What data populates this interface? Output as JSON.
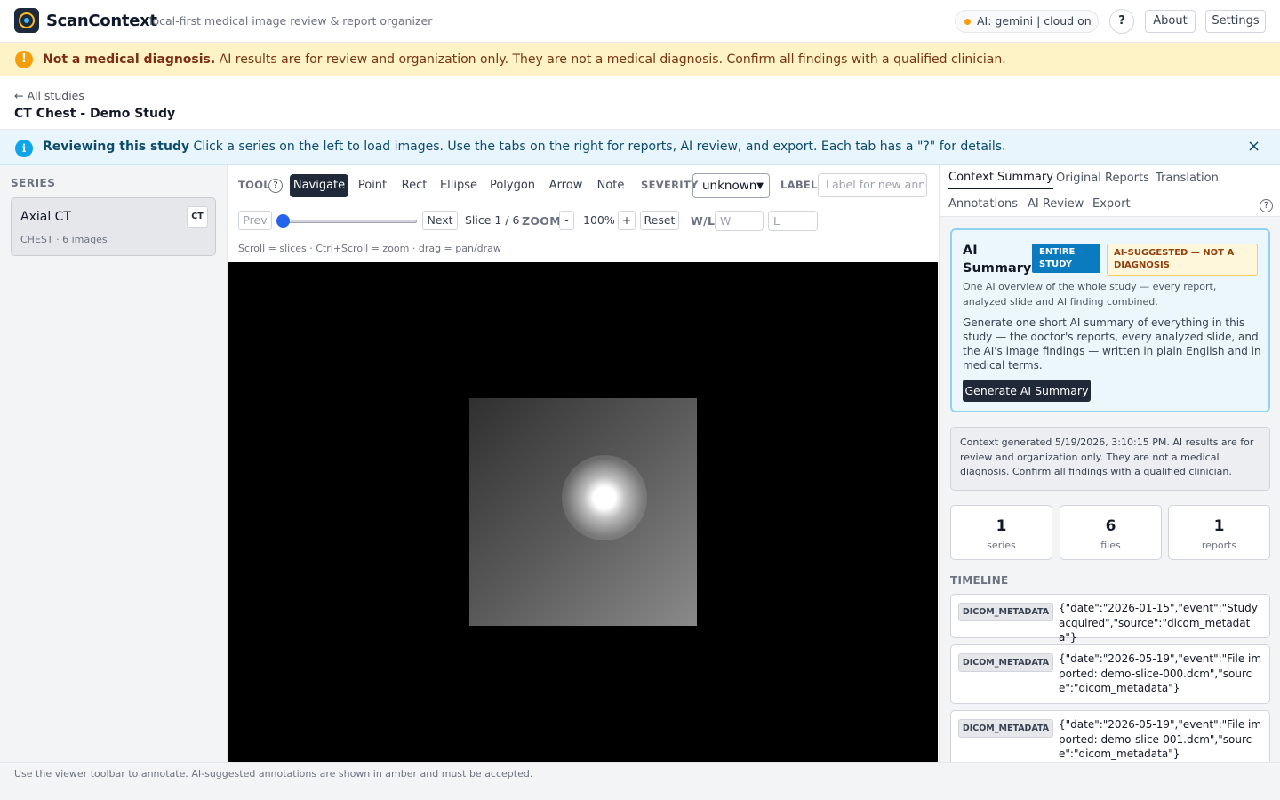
{
  "app": {
    "name": "ScanContext",
    "tagline": "local-first medical image review & report organizer",
    "ai_status": "AI:  gemini  |  cloud on",
    "help_label": "?",
    "about_label": "About",
    "settings_label": "Settings",
    "status_color": "#f59e0b"
  },
  "warning": {
    "icon": "!",
    "title": "Not a medical diagnosis.",
    "text": " AI results are for review and organization only. They are not a medical diagnosis. Confirm all findings with a qualified clinician."
  },
  "breadcrumb": {
    "back": "← All studies",
    "title": "CT Chest - Demo Study"
  },
  "info": {
    "icon": "i",
    "title": "Reviewing this study",
    "text": " Click a series on the left to load images. Use the tabs on the right for reports, AI review, and export. Each tab has a \"?\" for details.",
    "close": "×"
  },
  "series": {
    "header": "SERIES",
    "items": [
      {
        "name": "Axial CT",
        "meta": "CHEST · 6 images",
        "modality": "CT"
      }
    ]
  },
  "viewer": {
    "tool_label": "TOOL",
    "tool_help": "?",
    "tools": [
      "Navigate",
      "Point",
      "Rect",
      "Ellipse",
      "Polygon",
      "Arrow",
      "Note"
    ],
    "active_tool": "Navigate",
    "severity_label": "SEVERITY",
    "severity_value": "unknown",
    "label_label": "LABEL",
    "label_placeholder": "Label for new annotation",
    "prev": "Prev",
    "next": "Next",
    "slice_text": "Slice 1 / 6",
    "slice_position": 0,
    "zoom_label": "ZOOM",
    "zoom_minus": "-",
    "zoom_value": "100%",
    "zoom_plus": "+",
    "reset": "Reset",
    "wl_label": "W/L",
    "w_placeholder": "W",
    "l_placeholder": "L",
    "hint": "Scroll = slices · Ctrl+Scroll = zoom · drag = pan/draw"
  },
  "right": {
    "tabs": [
      "Context Summary",
      "Original Reports",
      "Translation",
      "Annotations",
      "AI Review",
      "Export"
    ],
    "active_tab": "Context Summary",
    "help": "?",
    "ai_summary": {
      "title": "AI Summary",
      "badge_scope": "ENTIRE STUDY",
      "badge_warning": "AI-SUGGESTED — NOT A DIAGNOSIS",
      "subtitle": "One AI overview of the whole study — every report, analyzed slide and AI finding combined.",
      "body": "Generate one short AI summary of everything in this study — the doctor's reports, every analyzed slide, and the AI's image findings — written in plain English and in medical terms.",
      "button": "Generate AI Summary"
    },
    "context_note": "Context generated 5/19/2026, 3:10:15 PM. AI results are for review and organization only. They are not a medical diagnosis. Confirm all findings with a qualified clinician.",
    "stats": [
      {
        "value": "1",
        "label": "series"
      },
      {
        "value": "6",
        "label": "files"
      },
      {
        "value": "1",
        "label": "reports"
      }
    ],
    "timeline_header": "TIMELINE",
    "timeline": [
      {
        "tag": "DICOM_METADATA",
        "text": "{\"date\":\"2026-01-15\",\"event\":\"Study acquired\",\"source\":\"dicom_metadata\"}"
      },
      {
        "tag": "DICOM_METADATA",
        "text": "{\"date\":\"2026-05-19\",\"event\":\"File imported: demo-slice-000.dcm\",\"source\":\"dicom_metadata\"}"
      },
      {
        "tag": "DICOM_METADATA",
        "text": "{\"date\":\"2026-05-19\",\"event\":\"File imported: demo-slice-001.dcm\",\"source\":\"dicom_metadata\"}"
      }
    ]
  },
  "footer": "Use the viewer toolbar to annotate. AI-suggested annotations are shown in amber and must be accepted."
}
